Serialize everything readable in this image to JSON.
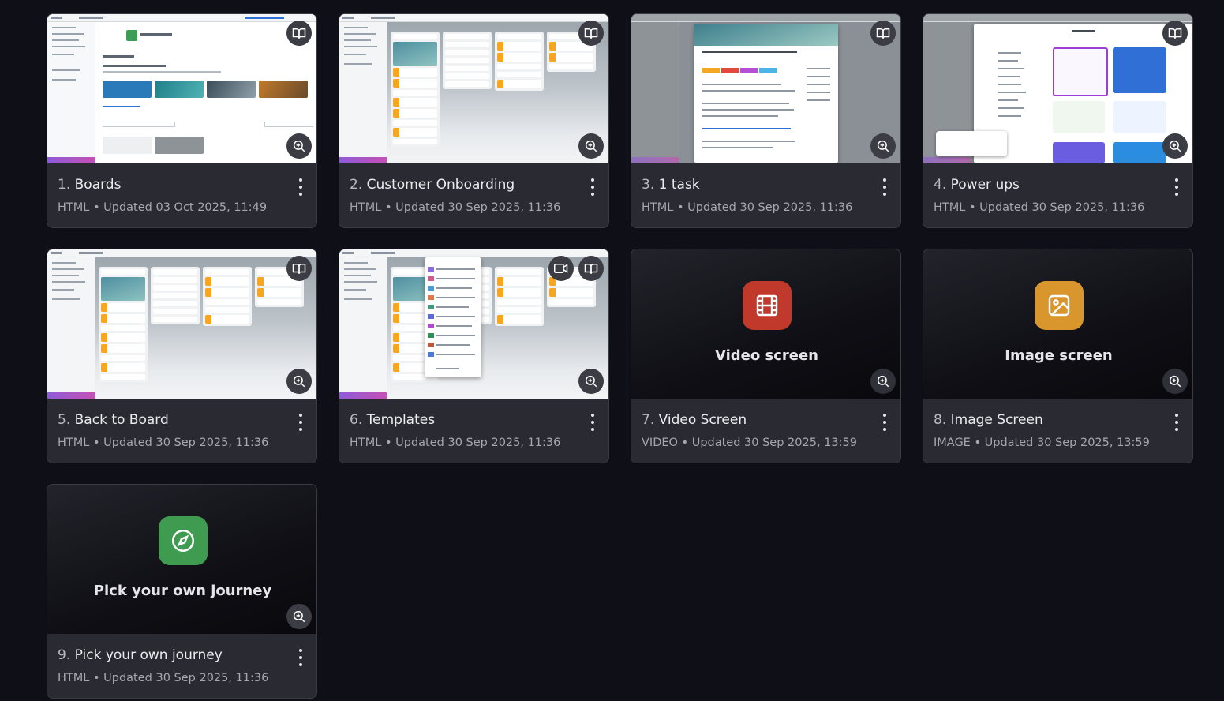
{
  "cards": [
    {
      "number": "1.",
      "title": "Boards",
      "type": "HTML",
      "updated": "Updated 03 Oct 2025, 11:49",
      "preview": "screenshot"
    },
    {
      "number": "2.",
      "title": "Customer Onboarding",
      "type": "HTML",
      "updated": "Updated 30 Sep 2025, 11:36",
      "preview": "screenshot"
    },
    {
      "number": "3.",
      "title": "1 task",
      "type": "HTML",
      "updated": "Updated 30 Sep 2025, 11:36",
      "preview": "screenshot"
    },
    {
      "number": "4.",
      "title": "Power ups",
      "type": "HTML",
      "updated": "Updated 30 Sep 2025, 11:36",
      "preview": "screenshot"
    },
    {
      "number": "5.",
      "title": "Back to Board",
      "type": "HTML",
      "updated": "Updated 30 Sep 2025, 11:36",
      "preview": "screenshot"
    },
    {
      "number": "6.",
      "title": "Templates",
      "type": "HTML",
      "updated": "Updated 30 Sep 2025, 11:36",
      "preview": "screenshot"
    },
    {
      "number": "7.",
      "title": "Video Screen",
      "type": "VIDEO",
      "updated": "Updated 30 Sep 2025, 13:59",
      "preview": "placeholder",
      "placeholder_label": "Video screen",
      "tile_color": "#c0392b",
      "tile_icon": "film-icon"
    },
    {
      "number": "8.",
      "title": "Image Screen",
      "type": "IMAGE",
      "updated": "Updated 30 Sep 2025, 13:59",
      "preview": "placeholder",
      "placeholder_label": "Image screen",
      "tile_color": "#d9962c",
      "tile_icon": "image-icon"
    },
    {
      "number": "9.",
      "title": "Pick your own journey",
      "type": "HTML",
      "updated": "Updated 30 Sep 2025, 11:36",
      "preview": "placeholder",
      "placeholder_label": "Pick your own journey",
      "tile_color": "#3f9b4f",
      "tile_icon": "compass-icon"
    }
  ],
  "separator": "•",
  "colors": {
    "background": "#0f0f17",
    "card": "#2a2b32",
    "card_border": "#3a3b44"
  }
}
